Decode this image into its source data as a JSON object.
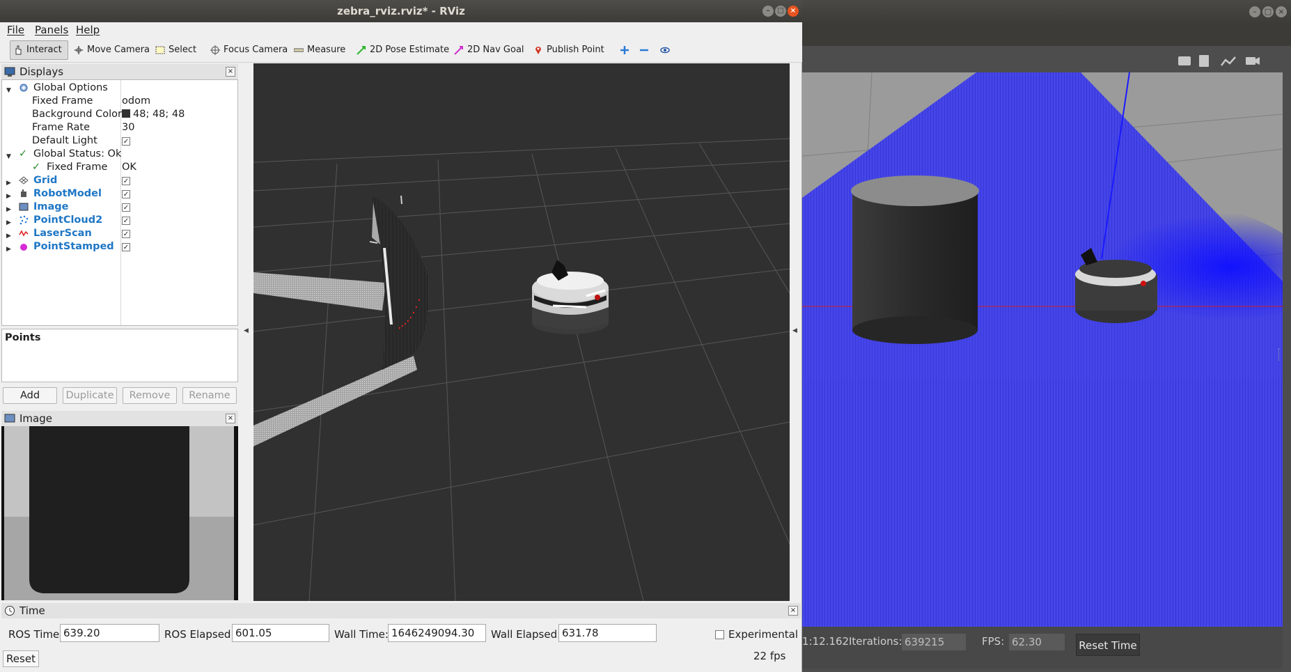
{
  "window": {
    "title": "zebra_rviz.rviz* - RViz"
  },
  "menu": [
    "File",
    "Panels",
    "Help"
  ],
  "toolbar": {
    "tools": [
      {
        "label": "Interact",
        "icon": "hand-pointer-icon",
        "active": true
      },
      {
        "label": "Move Camera",
        "icon": "move-camera-icon"
      },
      {
        "label": "Select",
        "icon": "select-box-icon"
      },
      {
        "label": "Focus Camera",
        "icon": "focus-camera-icon"
      },
      {
        "label": "Measure",
        "icon": "ruler-icon"
      },
      {
        "label": "2D Pose Estimate",
        "icon": "green-arrow-icon"
      },
      {
        "label": "2D Nav Goal",
        "icon": "pink-arrow-icon"
      },
      {
        "label": "Publish Point",
        "icon": "map-pin-icon"
      }
    ]
  },
  "displays": {
    "title": "Displays",
    "global_options": {
      "label": "Global Options",
      "fixed_frame_k": "Fixed Frame",
      "fixed_frame_v": "odom",
      "bg_k": "Background Color",
      "bg_v": "48; 48; 48",
      "bg_color": "#303030",
      "rate_k": "Frame Rate",
      "rate_v": "30",
      "light_k": "Default Light"
    },
    "global_status": {
      "label": "Global Status: Ok",
      "fixed_k": "Fixed Frame",
      "fixed_v": "OK"
    },
    "items": [
      {
        "label": "Grid"
      },
      {
        "label": "RobotModel"
      },
      {
        "label": "Image"
      },
      {
        "label": "PointCloud2"
      },
      {
        "label": "LaserScan"
      },
      {
        "label": "PointStamped"
      }
    ],
    "description_title": "Points",
    "buttons": {
      "add": "Add",
      "duplicate": "Duplicate",
      "remove": "Remove",
      "rename": "Rename"
    }
  },
  "image_panel": {
    "title": "Image"
  },
  "time_panel": {
    "title": "Time",
    "ros_time_label": "ROS Time:",
    "ros_time": "639.20",
    "ros_elapsed_label": "ROS Elapsed:",
    "ros_elapsed": "601.05",
    "wall_time_label": "Wall Time:",
    "wall_time": "1646249094.30",
    "wall_elapsed_label": "Wall Elapsed:",
    "wall_elapsed": "631.78",
    "experimental": "Experimental",
    "reset": "Reset",
    "fps": "22 fps"
  },
  "gazebo": {
    "real_time_fragment": "1:12.162",
    "iterations_label": "Iterations:",
    "iterations": "639215",
    "fps_label": "FPS:",
    "fps": "62.30",
    "reset_time": "Reset Time"
  },
  "colors": {
    "accent_blue": "#1f77c5",
    "laser_red": "#e02020",
    "point_magenta": "#d62ad6",
    "scan_blue": "#2233ee"
  }
}
